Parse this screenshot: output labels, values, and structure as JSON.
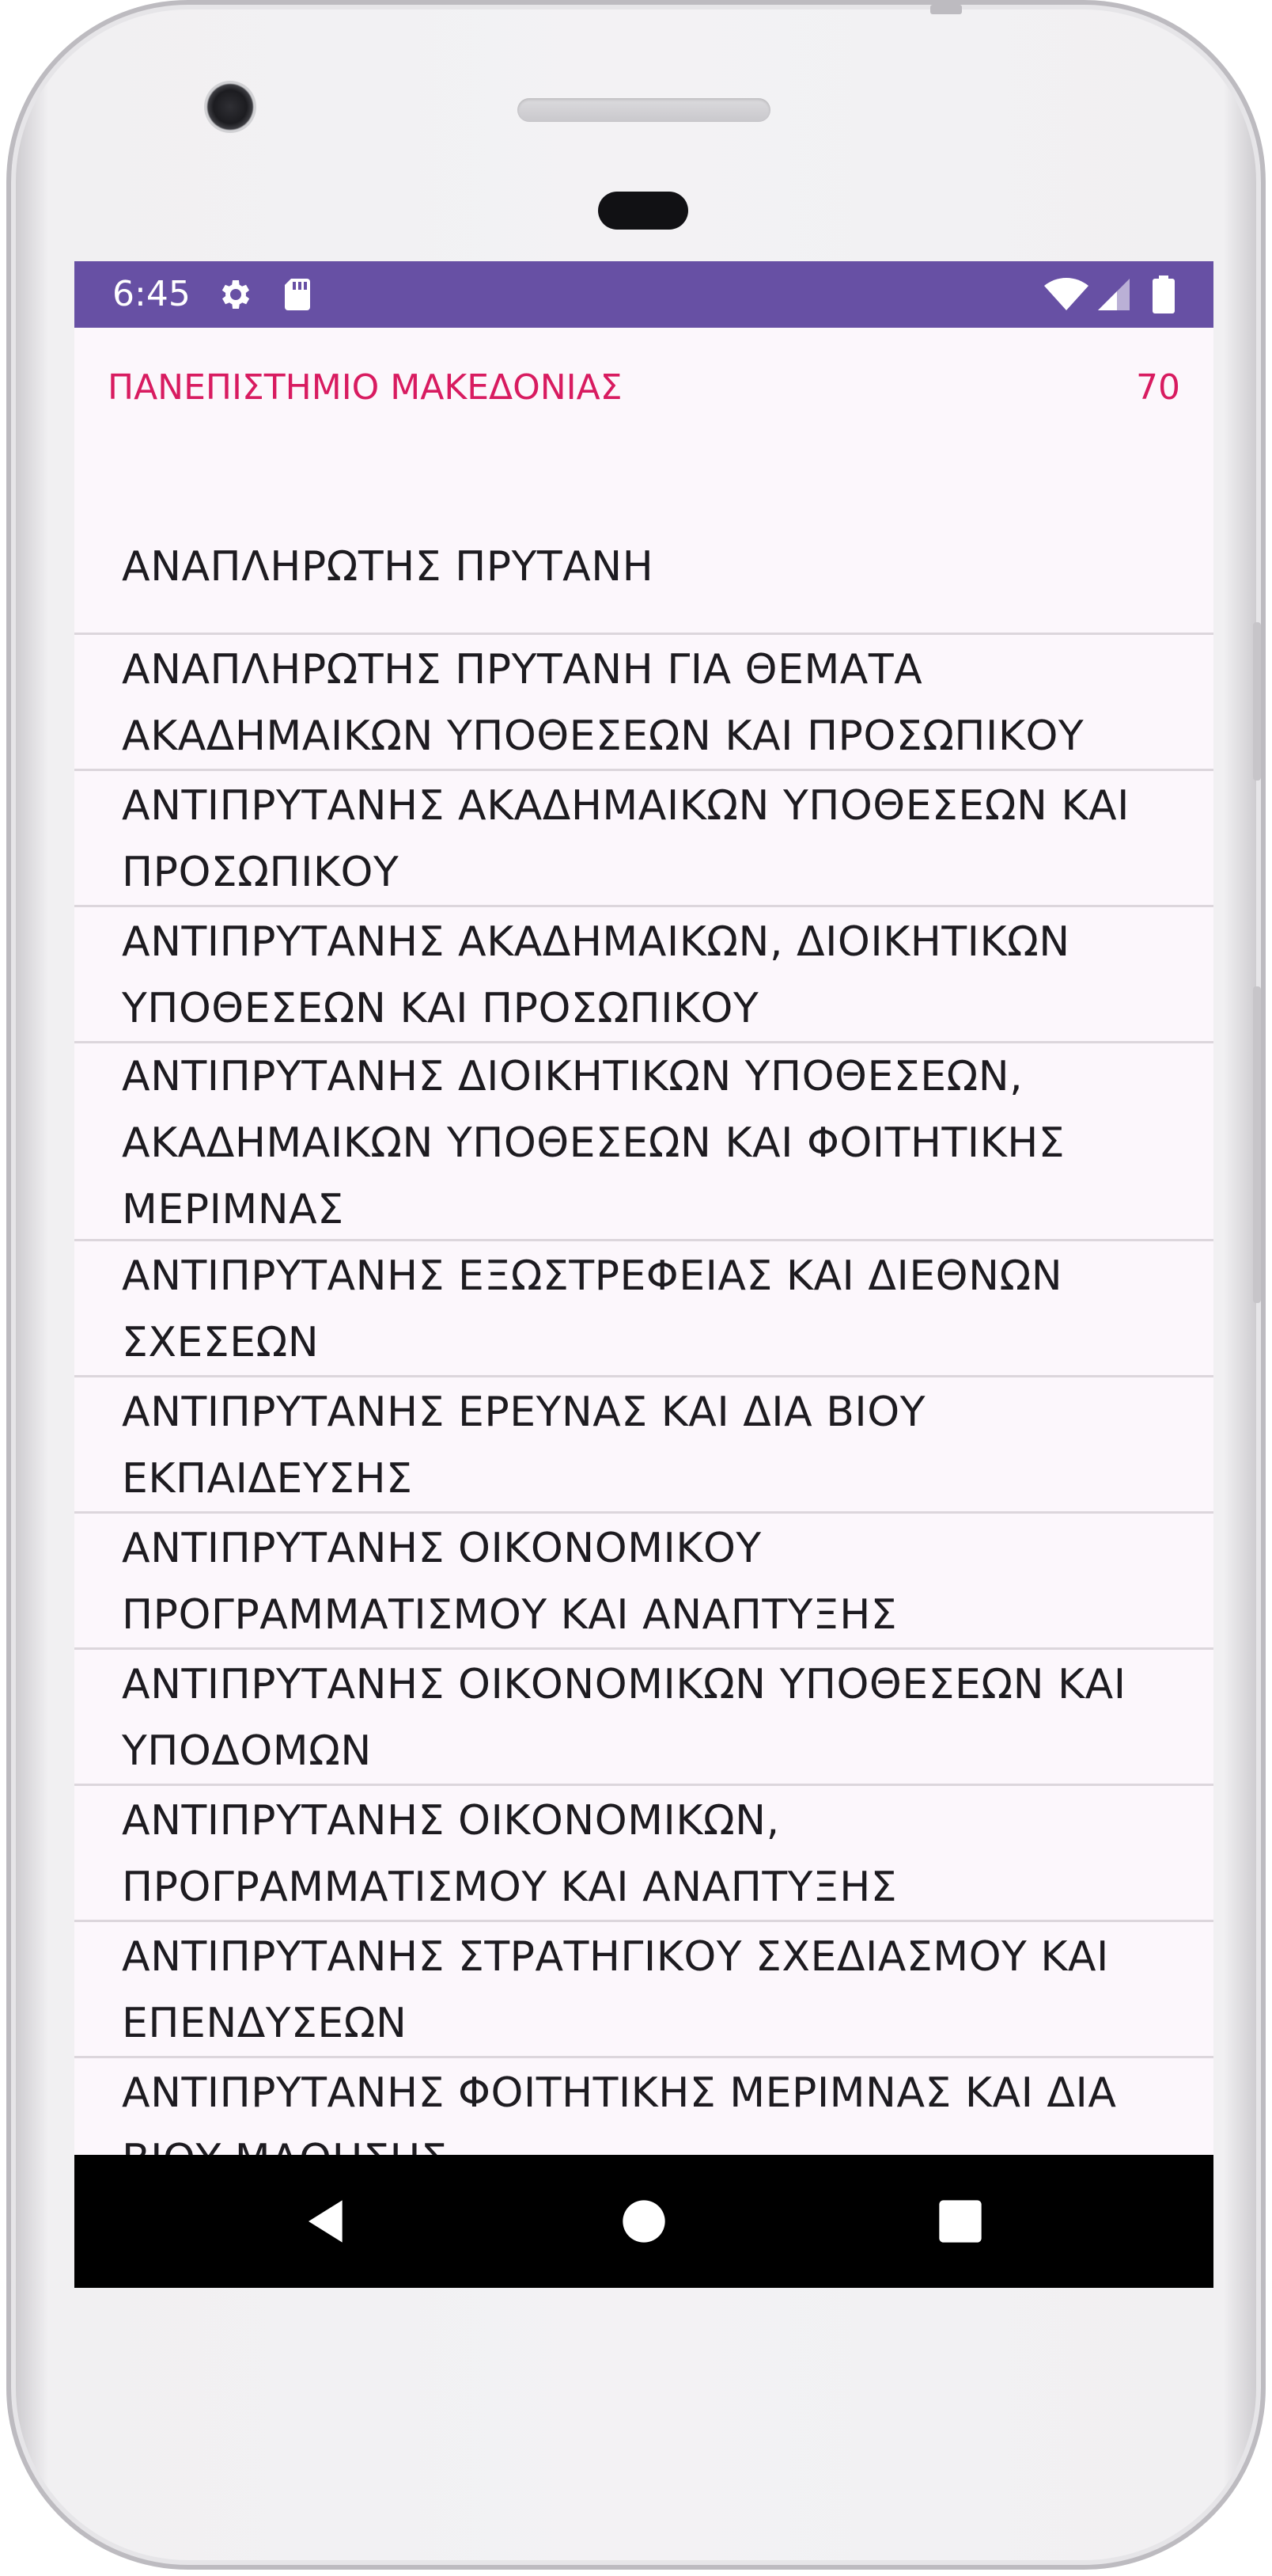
{
  "status_bar": {
    "time": "6:45",
    "icons_left": [
      "gear-icon",
      "sd-card-icon"
    ],
    "icons_right": [
      "wifi-icon",
      "cell-signal-icon",
      "battery-icon"
    ],
    "color": "#6750a4"
  },
  "header": {
    "title": "ΠΑΝΕΠΙΣΤΗΜΙΟ ΜΑΚΕΔΟΝΙΑΣ",
    "count": "70",
    "accent_color": "#d81b60"
  },
  "list": {
    "items": [
      {
        "lines": [
          "ΑΝΑΠΛΗΡΩΤΗΣ ΠΡΥΤΑΝΗ"
        ]
      },
      {
        "lines": [
          "ΑΝΑΠΛΗΡΩΤΗΣ ΠΡΥΤΑΝΗ ΓΙΑ ΘΕΜΑΤΑ",
          "ΑΚΑΔΗΜΑΙΚΩΝ ΥΠΟΘΕΣΕΩΝ ΚΑΙ ΠΡΟΣΩΠΙΚΟΥ"
        ]
      },
      {
        "lines": [
          "ΑΝΤΙΠΡΥΤΑΝΗΣ ΑΚΑΔΗΜΑΙΚΩΝ ΥΠΟΘΕΣΕΩΝ ΚΑΙ",
          "ΠΡΟΣΩΠΙΚΟΥ"
        ]
      },
      {
        "lines": [
          "ΑΝΤΙΠΡΥΤΑΝΗΣ ΑΚΑΔΗΜΑΙΚΩΝ, ΔΙΟΙΚΗΤΙΚΩΝ",
          "ΥΠΟΘΕΣΕΩΝ ΚΑΙ ΠΡΟΣΩΠΙΚΟΥ"
        ]
      },
      {
        "lines": [
          "ΑΝΤΙΠΡΥΤΑΝΗΣ ΔΙΟΙΚΗΤΙΚΩΝ ΥΠΟΘΕΣΕΩΝ,",
          "ΑΚΑΔΗΜΑΙΚΩΝ ΥΠΟΘΕΣΕΩΝ ΚΑΙ ΦΟΙΤΗΤΙΚΗΣ",
          "ΜΕΡΙΜΝΑΣ"
        ]
      },
      {
        "lines": [
          "ΑΝΤΙΠΡΥΤΑΝΗΣ ΕΞΩΣΤΡΕΦΕΙΑΣ ΚΑΙ ΔΙΕΘΝΩΝ",
          "ΣΧΕΣΕΩΝ"
        ]
      },
      {
        "lines": [
          "ΑΝΤΙΠΡΥΤΑΝΗΣ ΕΡΕΥΝΑΣ ΚΑΙ ΔΙΑ ΒΙΟΥ",
          "ΕΚΠΑΙΔΕΥΣΗΣ"
        ]
      },
      {
        "lines": [
          "ΑΝΤΙΠΡΥΤΑΝΗΣ ΟΙΚΟΝΟΜΙΚΟΥ",
          "ΠΡΟΓΡΑΜΜΑΤΙΣΜΟΥ ΚΑΙ ΑΝΑΠΤΥΞΗΣ"
        ]
      },
      {
        "lines": [
          "ΑΝΤΙΠΡΥΤΑΝΗΣ ΟΙΚΟΝΟΜΙΚΩΝ ΥΠΟΘΕΣΕΩΝ ΚΑΙ",
          "ΥΠΟΔΟΜΩΝ"
        ]
      },
      {
        "lines": [
          "ΑΝΤΙΠΡΥΤΑΝΗΣ ΟΙΚΟΝΟΜΙΚΩΝ,",
          "ΠΡΟΓΡΑΜΜΑΤΙΣΜΟΥ ΚΑΙ ΑΝΑΠΤΥΞΗΣ"
        ]
      },
      {
        "lines": [
          "ΑΝΤΙΠΡΥΤΑΝΗΣ ΣΤΡΑΤΗΓΙΚΟΥ ΣΧΕΔΙΑΣΜΟΥ ΚΑΙ",
          "ΕΠΕΝΔΥΣΕΩΝ"
        ]
      },
      {
        "lines": [
          "ΑΝΤΙΠΡΥΤΑΝΗΣ ΦΟΙΤΗΤΙΚΗΣ ΜΕΡΙΜΝΑΣ ΚΑΙ ΔΙΑ",
          "ΒΙΟΥ ΜΑΘΗΣΗΣ"
        ]
      }
    ]
  },
  "nav_bar": {
    "buttons": [
      "back-icon",
      "home-icon",
      "recents-icon"
    ]
  }
}
